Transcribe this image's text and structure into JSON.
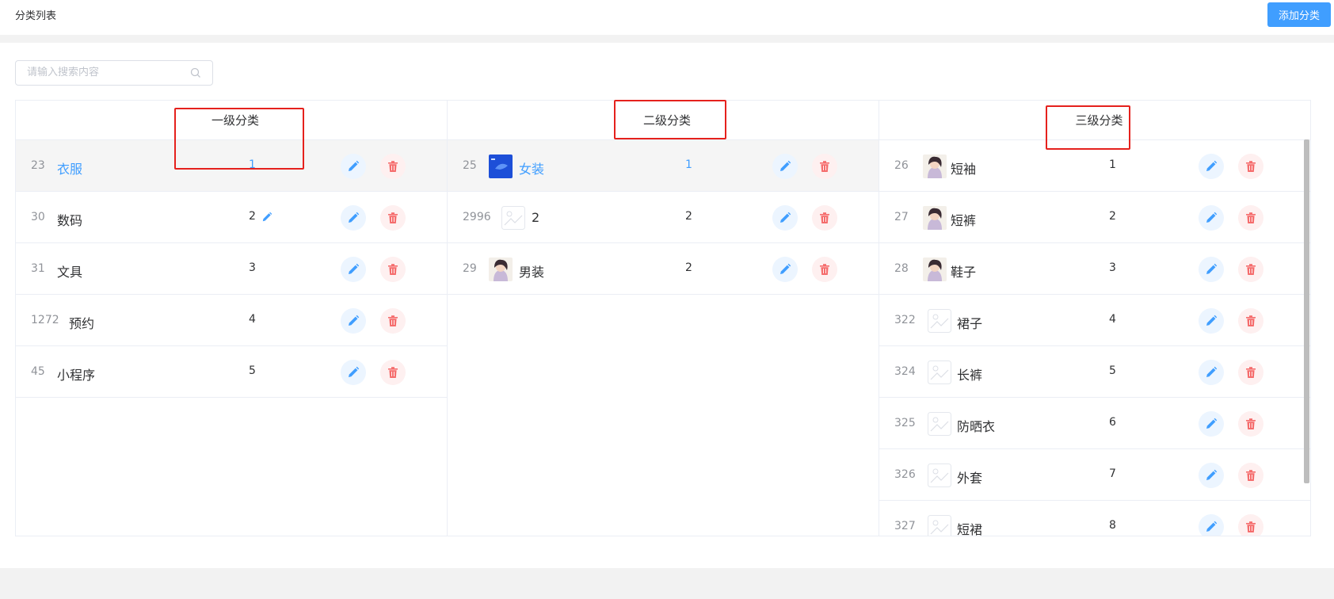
{
  "header": {
    "title": "分类列表",
    "add_button": "添加分类"
  },
  "search": {
    "placeholder": "请输入搜索内容"
  },
  "columns": [
    {
      "title": "一级分类",
      "rows": [
        {
          "id": "23",
          "name": "衣服",
          "sort": "1",
          "thumb": "none",
          "active": true
        },
        {
          "id": "30",
          "name": "数码",
          "sort": "2",
          "thumb": "none",
          "inline_edit": true
        },
        {
          "id": "31",
          "name": "文具",
          "sort": "3",
          "thumb": "none"
        },
        {
          "id": "1272",
          "name": "预约",
          "sort": "4",
          "thumb": "none"
        },
        {
          "id": "45",
          "name": "小程序",
          "sort": "5",
          "thumb": "none"
        }
      ]
    },
    {
      "title": "二级分类",
      "rows": [
        {
          "id": "25",
          "name": "女装",
          "sort": "1",
          "thumb": "blue-image",
          "active": true
        },
        {
          "id": "2996",
          "name": "2",
          "sort": "2",
          "thumb": "placeholder"
        },
        {
          "id": "29",
          "name": "男装",
          "sort": "2",
          "thumb": "avatar"
        }
      ]
    },
    {
      "title": "三级分类",
      "rows": [
        {
          "id": "26",
          "name": "短袖",
          "sort": "1",
          "thumb": "avatar"
        },
        {
          "id": "27",
          "name": "短裤",
          "sort": "2",
          "thumb": "avatar"
        },
        {
          "id": "28",
          "name": "鞋子",
          "sort": "3",
          "thumb": "avatar"
        },
        {
          "id": "322",
          "name": "裙子",
          "sort": "4",
          "thumb": "placeholder"
        },
        {
          "id": "324",
          "name": "长裤",
          "sort": "5",
          "thumb": "placeholder"
        },
        {
          "id": "325",
          "name": "防晒衣",
          "sort": "6",
          "thumb": "placeholder"
        },
        {
          "id": "326",
          "name": "外套",
          "sort": "7",
          "thumb": "placeholder"
        },
        {
          "id": "327",
          "name": "短裙",
          "sort": "8",
          "thumb": "placeholder"
        }
      ]
    }
  ],
  "colors": {
    "primary": "#409eff",
    "danger": "#f56c6c",
    "annotation": "#e5211d"
  }
}
